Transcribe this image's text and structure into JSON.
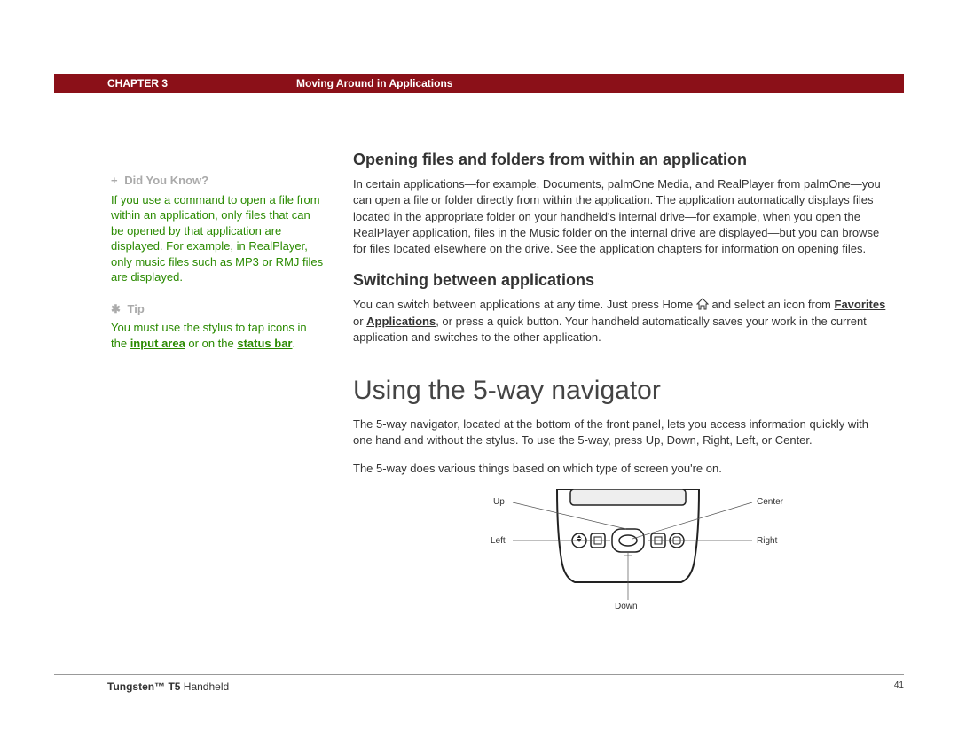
{
  "header": {
    "chapter": "CHAPTER 3",
    "title": "Moving Around in Applications"
  },
  "sidebar": {
    "didyouknow": {
      "label": "Did You Know?",
      "body": "If you use a command to open a file from within an application, only files that can be opened by that application are displayed. For example, in RealPlayer, only music files such as MP3 or RMJ files are displayed."
    },
    "tip": {
      "label": "Tip",
      "prefix": "You must use the stylus to tap icons in the ",
      "link1": "input area",
      "mid": " or on the ",
      "link2": "status bar",
      "suffix": "."
    }
  },
  "sections": {
    "opening": {
      "heading": "Opening files and folders from within an application",
      "body": "In certain applications—for example, Documents, palmOne Media, and RealPlayer from palmOne—you can open a file or folder directly from within the application. The application automatically displays files located in the appropriate folder on your handheld's internal drive—for example, when you open the RealPlayer application, files in the Music folder on the internal drive are displayed—but you can browse for files located elsewhere on the drive. See the application chapters for information on opening files."
    },
    "switching": {
      "heading": "Switching between applications",
      "pre": "You can switch between applications at any time. Just press Home ",
      "post_icon": " and select an icon from ",
      "fav": "Favorites",
      "or": " or ",
      "apps": "Applications",
      "rest": ", or press a quick button. Your handheld automatically saves your work in the current application and switches to the other application."
    },
    "navigator": {
      "heading": "Using the 5-way navigator",
      "p1": "The 5-way navigator, located at the bottom of the front panel, lets you access information quickly with one hand and without the stylus. To use the 5-way, press Up, Down, Right, Left, or Center.",
      "p2": "The 5-way does various things based on which type of screen you're on."
    }
  },
  "diagram": {
    "up": "Up",
    "down": "Down",
    "left": "Left",
    "right": "Right",
    "center": "Center"
  },
  "footer": {
    "product_bold": "Tungsten™ T5",
    "product_rest": " Handheld",
    "page": "41"
  }
}
